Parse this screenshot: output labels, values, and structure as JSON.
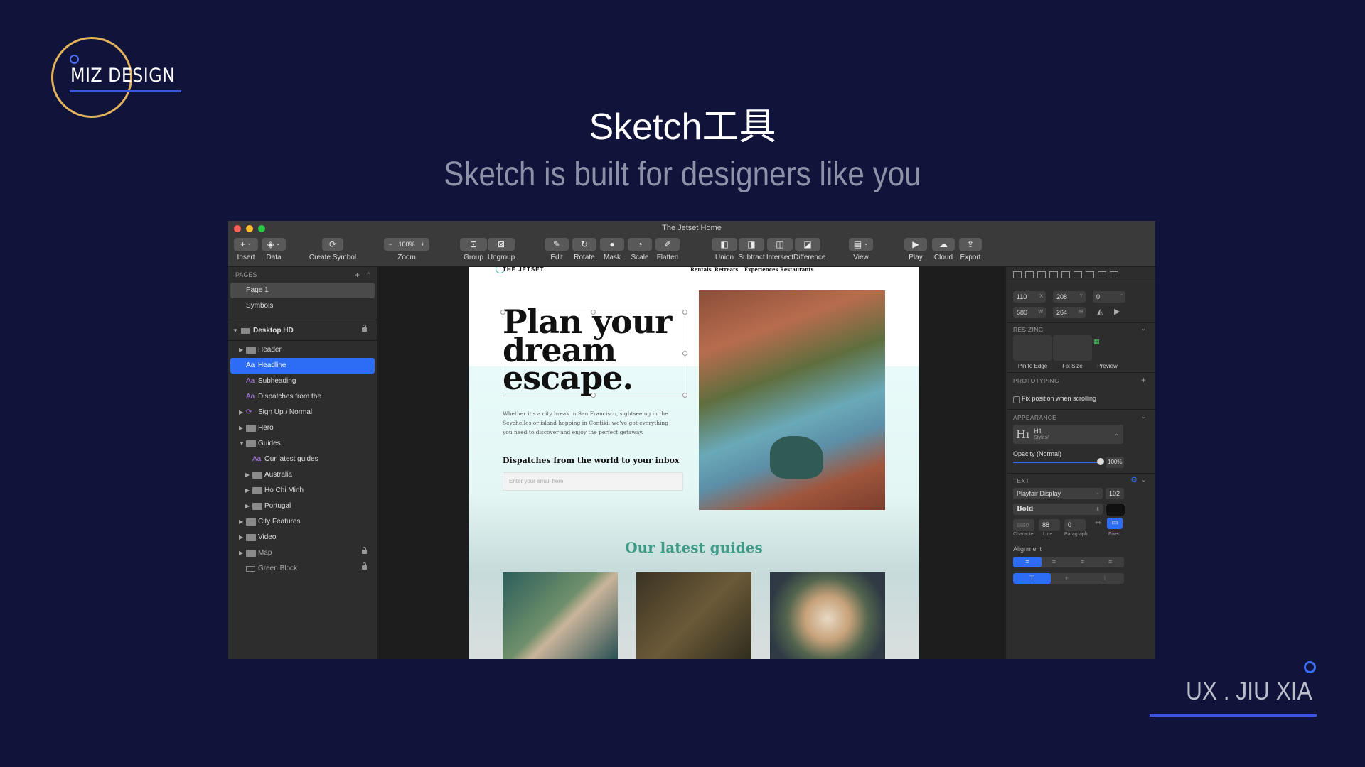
{
  "slide": {
    "logo_text": "MIZ DESIGN",
    "title": "Sketch工具",
    "subtitle": "Sketch is built for designers like you",
    "footer": "UX . JIU XIA"
  },
  "window": {
    "title": "The Jetset Home",
    "toolbar": [
      "Insert",
      "Data",
      "Create Symbol",
      "Zoom",
      "Group",
      "Ungroup",
      "Edit",
      "Rotate",
      "Mask",
      "Scale",
      "Flatten",
      "Union",
      "Subtract",
      "Intersect",
      "Difference",
      "View",
      "Play",
      "Cloud",
      "Export"
    ],
    "zoom_value": "100%"
  },
  "left_panel": {
    "pages_header": "PAGES",
    "pages": [
      "Page 1",
      "Symbols"
    ],
    "artboard": "Desktop HD",
    "layers": [
      "Header",
      "Headline",
      "Subheading",
      "Dispatches from the",
      "Sign Up / Normal",
      "Hero",
      "Guides",
      "Our latest guides",
      "Australia",
      "Ho Chi Minh",
      "Portugal",
      "City Features",
      "Video",
      "Map",
      "Green Block"
    ]
  },
  "artboard": {
    "brand": "THE JETSET",
    "nav": [
      "Rentals",
      "Retreats",
      "Experiences",
      "Restaurants"
    ],
    "headline": "Plan your dream escape.",
    "body": "Whether it's a city break in San Francisco, sightseeing in the Seychelles or island hopping in Contiki, we've got everything you need to discover and enjoy the perfect getaway.",
    "dispatch": "Dispatches from the world to your inbox",
    "email_placeholder": "Enter your email here",
    "guides_title": "Our latest guides"
  },
  "inspector": {
    "x": "110",
    "y": "208",
    "rotation": "0",
    "w": "580",
    "h": "264",
    "x_label": "X",
    "y_label": "Y",
    "w_label": "W",
    "h_label": "H",
    "deg": "°",
    "resizing": "RESIZING",
    "pin_to_edge": "Pin to Edge",
    "fix_size": "Fix Size",
    "preview": "Preview",
    "prototyping": "PROTOTYPING",
    "fix_position": "Fix position when scrolling",
    "appearance": "APPEARANCE",
    "style_name": "H1",
    "style_sub": "Styles/",
    "opacity_label": "Opacity (Normal)",
    "opacity_value": "100%",
    "text_header": "TEXT",
    "font": "Playfair Display",
    "font_size": "102",
    "weight": "Bold",
    "character": "auto",
    "line": "88",
    "paragraph": "0",
    "character_label": "Character",
    "line_label": "Line",
    "paragraph_label": "Paragraph",
    "fixed_label": "Fixed",
    "alignment": "Alignment"
  },
  "colors": {
    "background": "#10143a",
    "accent": "#2d6df6",
    "logo_ring": "#e3b25b"
  }
}
